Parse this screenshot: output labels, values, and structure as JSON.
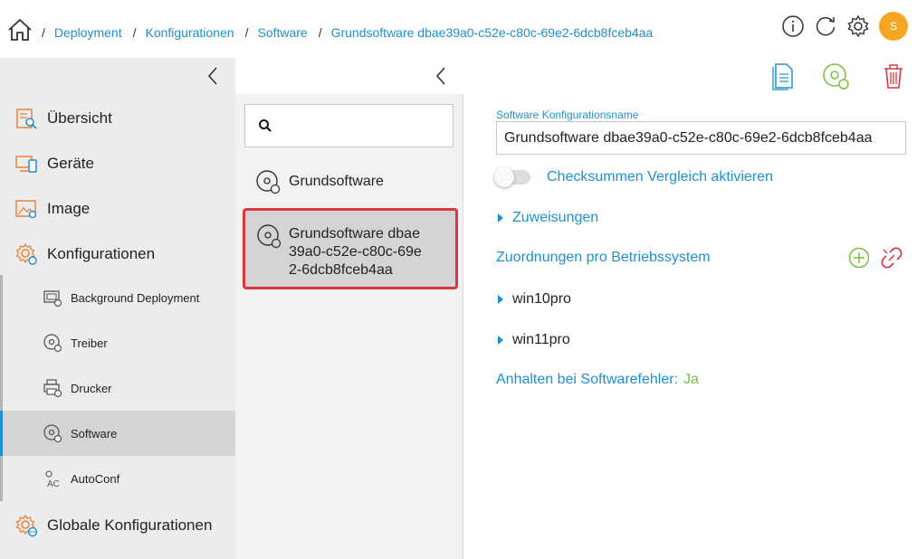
{
  "breadcrumb": {
    "items": [
      "Deployment",
      "Konfigurationen",
      "Software",
      "Grundsoftware dbae39a0-c52e-c80c-69e2-6dcb8fceb4aa"
    ]
  },
  "user": {
    "avatar_initial": "S"
  },
  "sidebar": {
    "items": [
      {
        "label": "Übersicht",
        "icon": "overview-icon"
      },
      {
        "label": "Geräte",
        "icon": "devices-icon"
      },
      {
        "label": "Image",
        "icon": "image-icon"
      },
      {
        "label": "Konfigurationen",
        "icon": "gears-icon"
      },
      {
        "label": "Globale Konfigurationen",
        "icon": "globe-gear-icon"
      }
    ],
    "sub_items": [
      {
        "label": "Background Deployment",
        "icon": "background-deployment-icon"
      },
      {
        "label": "Treiber",
        "icon": "driver-disc-icon"
      },
      {
        "label": "Drucker",
        "icon": "printer-icon"
      },
      {
        "label": "Software",
        "icon": "software-disc-icon",
        "active": true
      },
      {
        "label": "AutoConf",
        "icon": "autoconf-icon"
      }
    ]
  },
  "list": {
    "search_placeholder": "",
    "items": [
      {
        "label": "Grundsoftware",
        "selected": false
      },
      {
        "label_lines": [
          "Grundsoftware dbae",
          "39a0-c52e-c80c-69e",
          "2-6dcb8fceb4aa"
        ],
        "selected": true
      }
    ]
  },
  "detail": {
    "name_label": "Software Konfigurationsname",
    "name_value": "Grundsoftware dbae39a0-c52e-c80c-69e2-6dcb8fceb4aa",
    "checksum_label": "Checksummen Vergleich aktivieren",
    "checksum_enabled": false,
    "assignments_label": "Zuweisungen",
    "os_section_title": "Zuordnungen pro Betriebssystem",
    "os_items": [
      "win10pro",
      "win11pro"
    ],
    "halt_label": "Anhalten bei Softwarefehler:",
    "halt_value": "Ja"
  },
  "colors": {
    "accent": "#1e8fd0",
    "green": "#7cc142",
    "red": "#d9363e",
    "avatar": "#f5a623"
  }
}
